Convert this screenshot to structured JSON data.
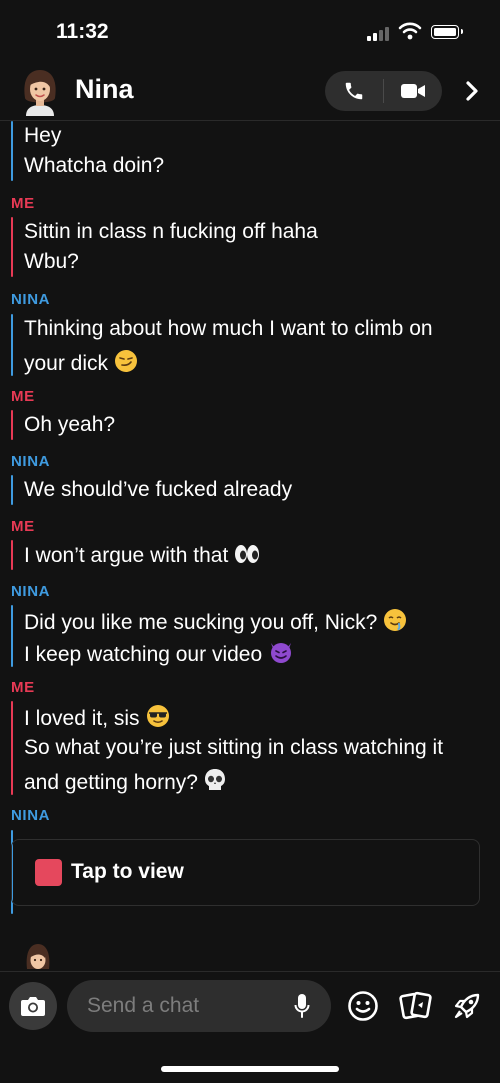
{
  "status_bar": {
    "time": "11:32"
  },
  "header": {
    "name": "Nina"
  },
  "labels": {
    "me": "ME",
    "nina": "NINA"
  },
  "messages": [
    {
      "sender": "nina",
      "lines": [
        "Hey",
        "Whatcha doin?"
      ]
    },
    {
      "sender": "me",
      "lines": [
        "Sittin in class n fucking off haha",
        "Wbu?"
      ]
    },
    {
      "sender": "nina",
      "lines": [
        "Thinking about how much I want to climb on",
        "your dick"
      ]
    },
    {
      "sender": "me",
      "lines": [
        "Oh yeah?"
      ]
    },
    {
      "sender": "nina",
      "lines": [
        "We should’ve fucked already"
      ]
    },
    {
      "sender": "me",
      "lines": [
        "I won’t argue with that"
      ]
    },
    {
      "sender": "nina",
      "lines": [
        "Did you like me sucking you off, Nick?",
        "I keep watching our video"
      ]
    },
    {
      "sender": "me",
      "lines": [
        "I loved it, sis",
        "So what you’re just sitting in class watching it",
        "and getting horny?"
      ]
    }
  ],
  "snap": {
    "label": "Tap to view"
  },
  "composer": {
    "placeholder": "Send a chat"
  },
  "icons": {
    "phone": "phone-icon",
    "video": "video-camera-icon",
    "forward": "chevron-right-icon",
    "camera": "camera-icon",
    "mic": "microphone-icon",
    "emoji": "smiley-icon",
    "stickers": "sticker-cards-icon",
    "games": "rocket-icon"
  },
  "colors": {
    "me": "#e83a55",
    "nina": "#3f9be0",
    "snap": "#e5485d",
    "background": "#121212"
  }
}
